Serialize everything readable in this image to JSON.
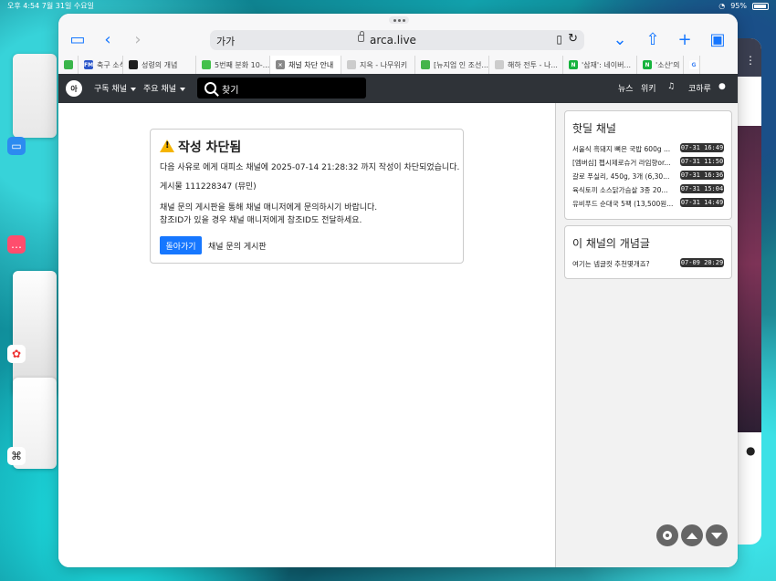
{
  "status": {
    "time_date": "오후 4:54 7월 31일 수요일",
    "battery": "95%"
  },
  "browser": {
    "aa_label": "가가",
    "url": "arca.live",
    "tabs": [
      {
        "label": "",
        "icon": "green-favicon-icon",
        "color": "#39b54a"
      },
      {
        "label": "축구 소식",
        "icon": "fm-favicon-icon",
        "color": "#2b56c9"
      },
      {
        "label": "성령의 개념",
        "icon": "dark-favicon-icon",
        "color": "#1e1e1e"
      },
      {
        "label": "5번째 분화 10-...",
        "icon": "comment-favicon-icon",
        "color": "#44c04b"
      },
      {
        "label": "채널 차단 안내",
        "icon": "close-favicon-icon",
        "color": "#888888"
      },
      {
        "label": "지옥 - 나무위키",
        "icon": "gray-favicon-icon",
        "color": "#cccccc"
      },
      {
        "label": "[뉴지엄 인 조선...",
        "icon": "mail-favicon-icon",
        "color": "#45b44a"
      },
      {
        "label": "해하 전투 - 나...",
        "icon": "gray-favicon-icon",
        "color": "#cccccc"
      },
      {
        "label": "'삼재': 네이버...",
        "icon": "naver-favicon-icon",
        "color": "#16b33d"
      },
      {
        "label": "'소산'의",
        "icon": "naver-favicon-icon",
        "color": "#16b33d"
      },
      {
        "label": "",
        "icon": "google-favicon-icon",
        "color": "#4285f4"
      }
    ]
  },
  "site": {
    "logo_text": "아",
    "nav": {
      "subscribed": "구독 채널",
      "main": "주요 채널",
      "search_placeholder": "찾기",
      "news": "뉴스",
      "wiki": "위키",
      "username": "코하루"
    }
  },
  "notice": {
    "title": "작성 차단됨",
    "line1": "다음 사유로 에게 대피소 채널에 2025-07-14 21:28:32 까지 작성이 차단되었습니다.",
    "line2": "게시물 111228347 (뮤민)",
    "line3": "채널 문의 게시판을 통해 채널 매니저에게 문의하시기 바랍니다.",
    "line4": "참조ID가 있을 경우 채널 매니저에게 참조ID도 전달하세요.",
    "back_button": "돌아가기",
    "inquiry_link": "채널 문의 게시판"
  },
  "sidebar": {
    "hot_title": "핫딜 채널",
    "hot_posts": [
      {
        "title": "서울식 흑돼지 뼈은 국밥 600g ...",
        "date": "07-31 16:49"
      },
      {
        "title": "[엠버심] 펩시제로슈거 라임향or...",
        "date": "07-31 11:50"
      },
      {
        "title": "갈로 푸실리, 450g, 3개 (6,30...",
        "date": "07-31 16:36"
      },
      {
        "title": "육식토끼 소스닭가슴살 3종 20...",
        "date": "07-31 15:04"
      },
      {
        "title": "유비푸드 순대국 5팩 (13,500원...",
        "date": "07-31 14:49"
      }
    ],
    "concept_title": "이 채널의 개념글",
    "concept_posts": [
      {
        "title": "여기는 넴글컷 추천몇개죠?",
        "date": "07-09 20:29"
      }
    ]
  },
  "colors": {
    "accent": "#1677ff",
    "navbar": "#2f3338",
    "warning": "#f5b400"
  }
}
